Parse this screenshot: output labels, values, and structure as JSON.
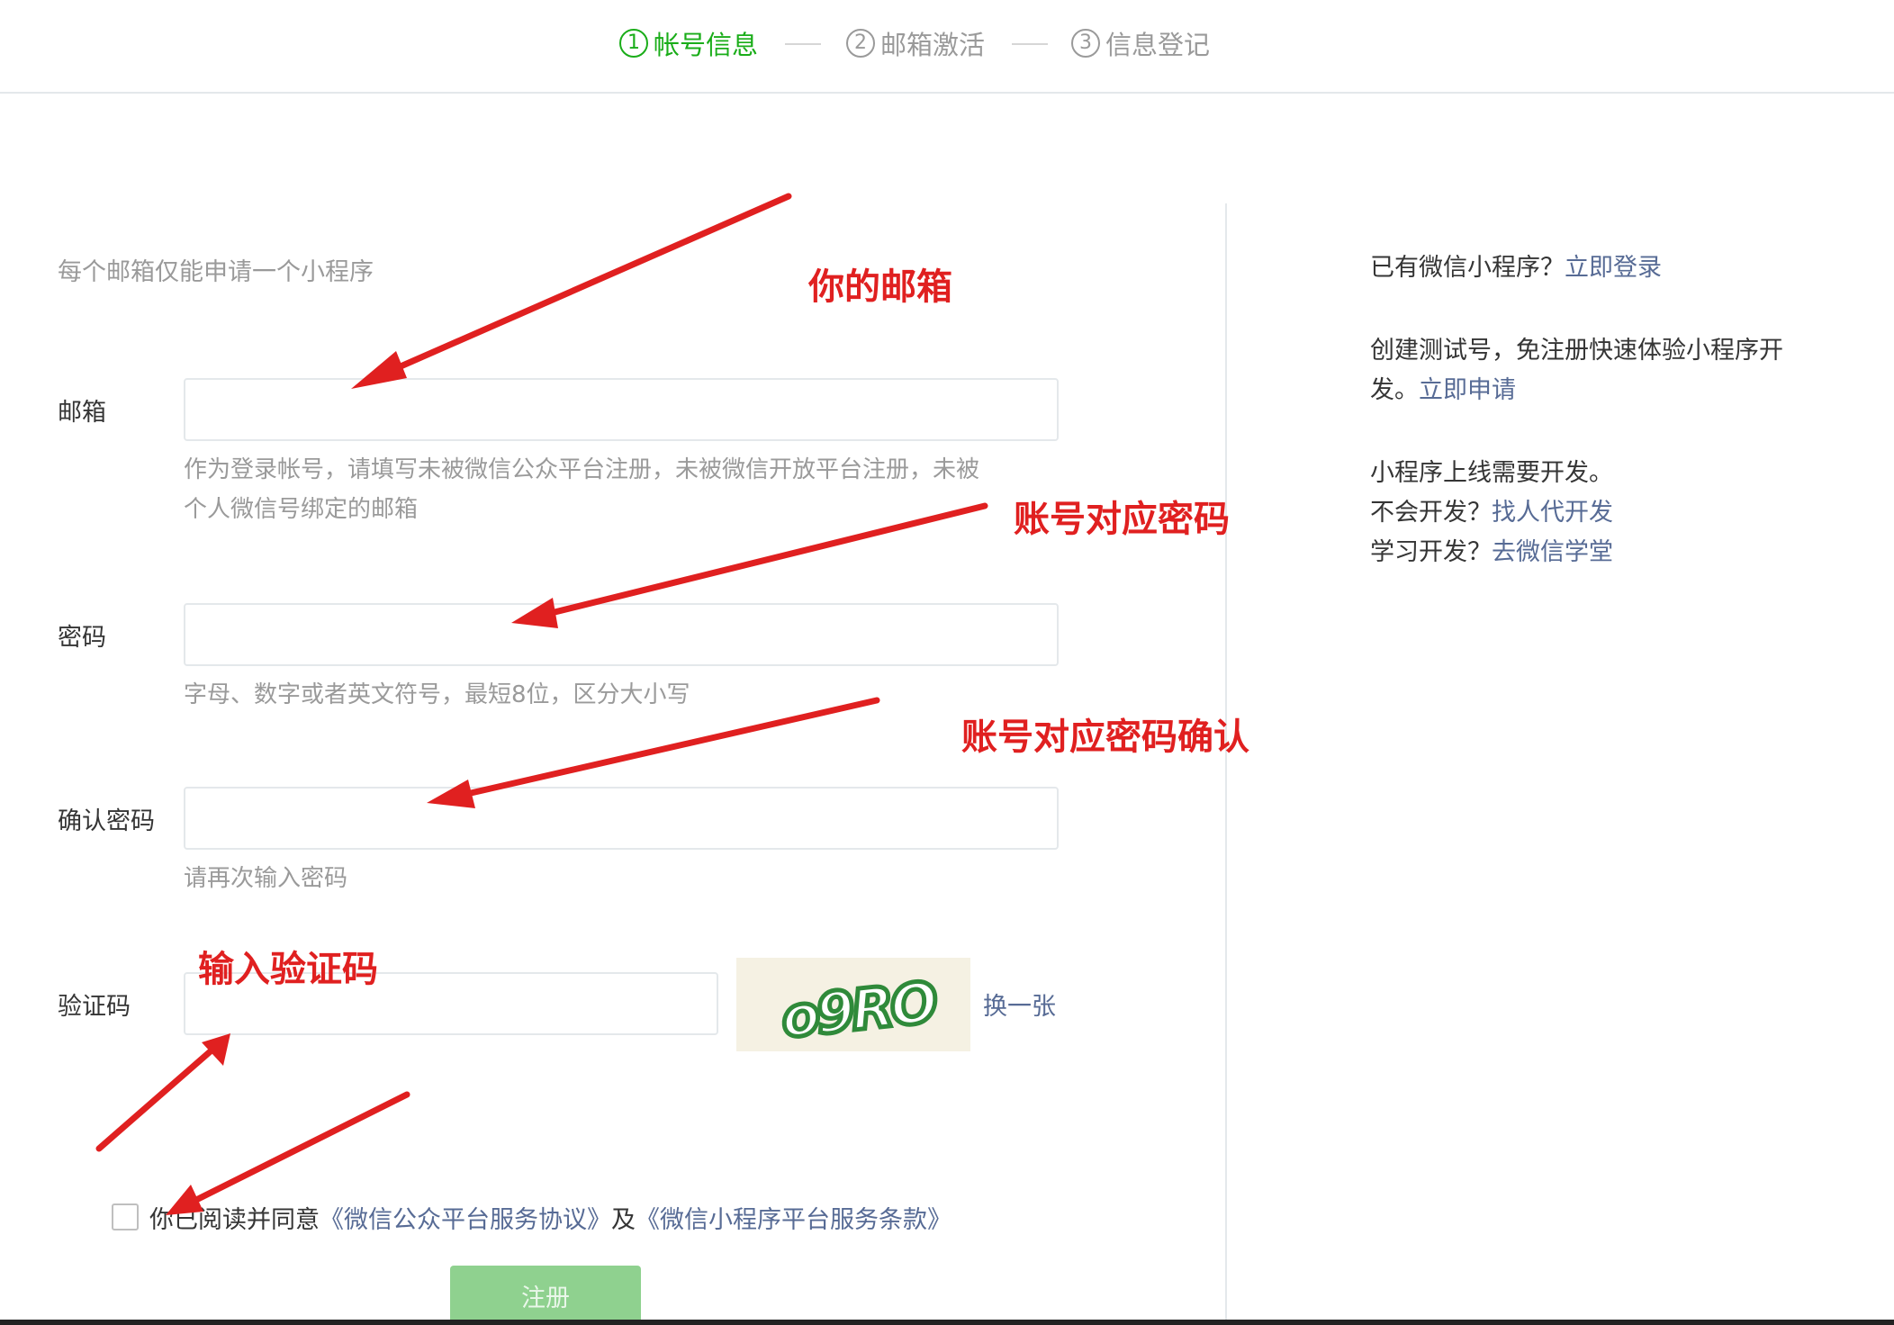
{
  "steps": [
    {
      "num": "1",
      "label": "帐号信息",
      "active": true
    },
    {
      "num": "2",
      "label": "邮箱激活",
      "active": false
    },
    {
      "num": "3",
      "label": "信息登记",
      "active": false
    }
  ],
  "form": {
    "notice": "每个邮箱仅能申请一个小程序",
    "email": {
      "label": "邮箱",
      "value": "",
      "tip_line1": "作为登录帐号，请填写未被微信公众平台注册，未被微信开放平台注册，未被",
      "tip_line2": "个人微信号绑定的邮箱"
    },
    "password": {
      "label": "密码",
      "value": "",
      "tip": "字母、数字或者英文符号，最短8位，区分大小写"
    },
    "confirm": {
      "label": "确认密码",
      "value": "",
      "tip": "请再次输入密码"
    },
    "captcha": {
      "label": "验证码",
      "value": "",
      "image_text": "o9RO",
      "refresh": "换一张"
    },
    "agree": {
      "prefix": "你已阅读并同意",
      "link1": "《微信公众平台服务协议》",
      "middle": "及",
      "link2": "《微信小程序平台服务条款》",
      "checked": false
    },
    "submit": "注册"
  },
  "sidebar": {
    "login_text": "已有微信小程序？",
    "login_link": "立即登录",
    "test_text_line1": "创建测试号，免注册快速体验小程序开",
    "test_text_line2": "发。",
    "test_link": "立即申请",
    "dev_line": "小程序上线需要开发。",
    "nodev_text": "不会开发？",
    "nodev_link": "找人代开发",
    "learn_text": "学习开发？",
    "learn_link": "去微信学堂"
  },
  "annotations": {
    "email": "你的邮箱",
    "password": "账号对应密码",
    "confirm": "账号对应密码确认",
    "captcha": "输入验证码"
  },
  "colors": {
    "active": "#1aad19",
    "link": "#576b95",
    "annotation": "#e02020",
    "submit": "#8fd18f"
  }
}
